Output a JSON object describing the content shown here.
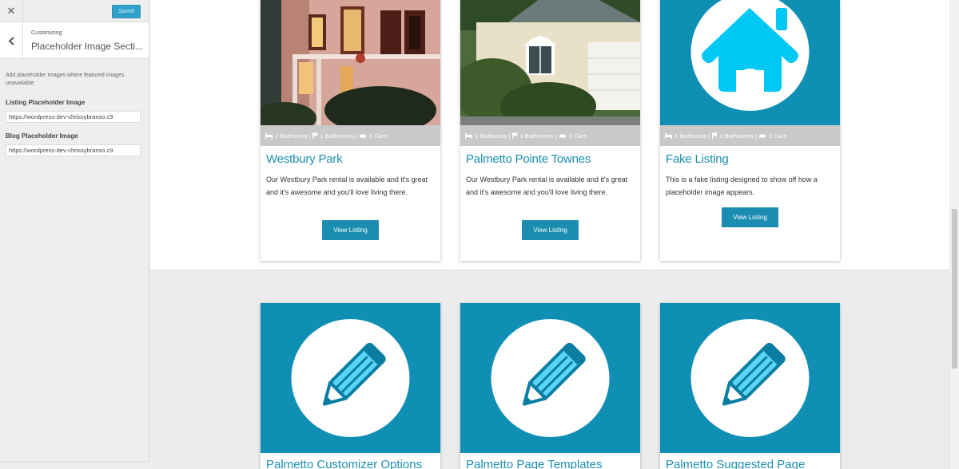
{
  "sidebar": {
    "close_label": "✕",
    "saved_label": "Saved",
    "breadcrumb": "Customizing",
    "section_title": "Placeholder Image Secti...",
    "description": "Add placeholder images where featured images unavailable.",
    "listing_label": "Listing Placeholder Image",
    "listing_value": "https://wordpress-dev-chrissybranso.c9",
    "blog_label": "Blog Placeholder Image",
    "blog_value": "https://wordpress-dev-chrissybranso.c9"
  },
  "listings": [
    {
      "meta": "1 Bedrooms | 1 Bathrooms | 1 Cars",
      "bedrooms": "1 Bedrooms",
      "bathrooms": "1 Bathrooms",
      "cars": "1 Cars",
      "title": "Westbury Park",
      "text": "Our Westbury Park rental is available and it's great and it's awesome and you'll love living there.",
      "button": "View Listing",
      "image": "house-photo-pink"
    },
    {
      "bedrooms": "1 Bedrooms",
      "bathrooms": "1 Bathrooms",
      "cars": "1 Cars",
      "title": "Palmetto Pointe Townes",
      "text": "Our Westbury Park rental is available and it's great and it's awesome and you'll love living there.",
      "button": "View Listing",
      "image": "house-photo-garage"
    },
    {
      "bedrooms": "1 Bedrooms",
      "bathrooms": "1 Bathrooms",
      "cars": "1 Cars",
      "title": "Fake Listing",
      "text": "This is a fake listing designed to show off how a placeholder image appears.",
      "button": "View Listing",
      "image": "house-placeholder-icon"
    }
  ],
  "posts": [
    {
      "title": "Palmetto Customizer Options",
      "image": "pencil-placeholder-icon"
    },
    {
      "title": "Palmetto Page Templates",
      "image": "pencil-placeholder-icon"
    },
    {
      "title": "Palmetto Suggested Page",
      "image": "pencil-placeholder-icon"
    }
  ],
  "colors": {
    "accent": "#1a8db0",
    "placeholder_bg": "#0f8fb3",
    "icon_blue": "#00c8f5",
    "saved_button": "#2ea2cc"
  }
}
